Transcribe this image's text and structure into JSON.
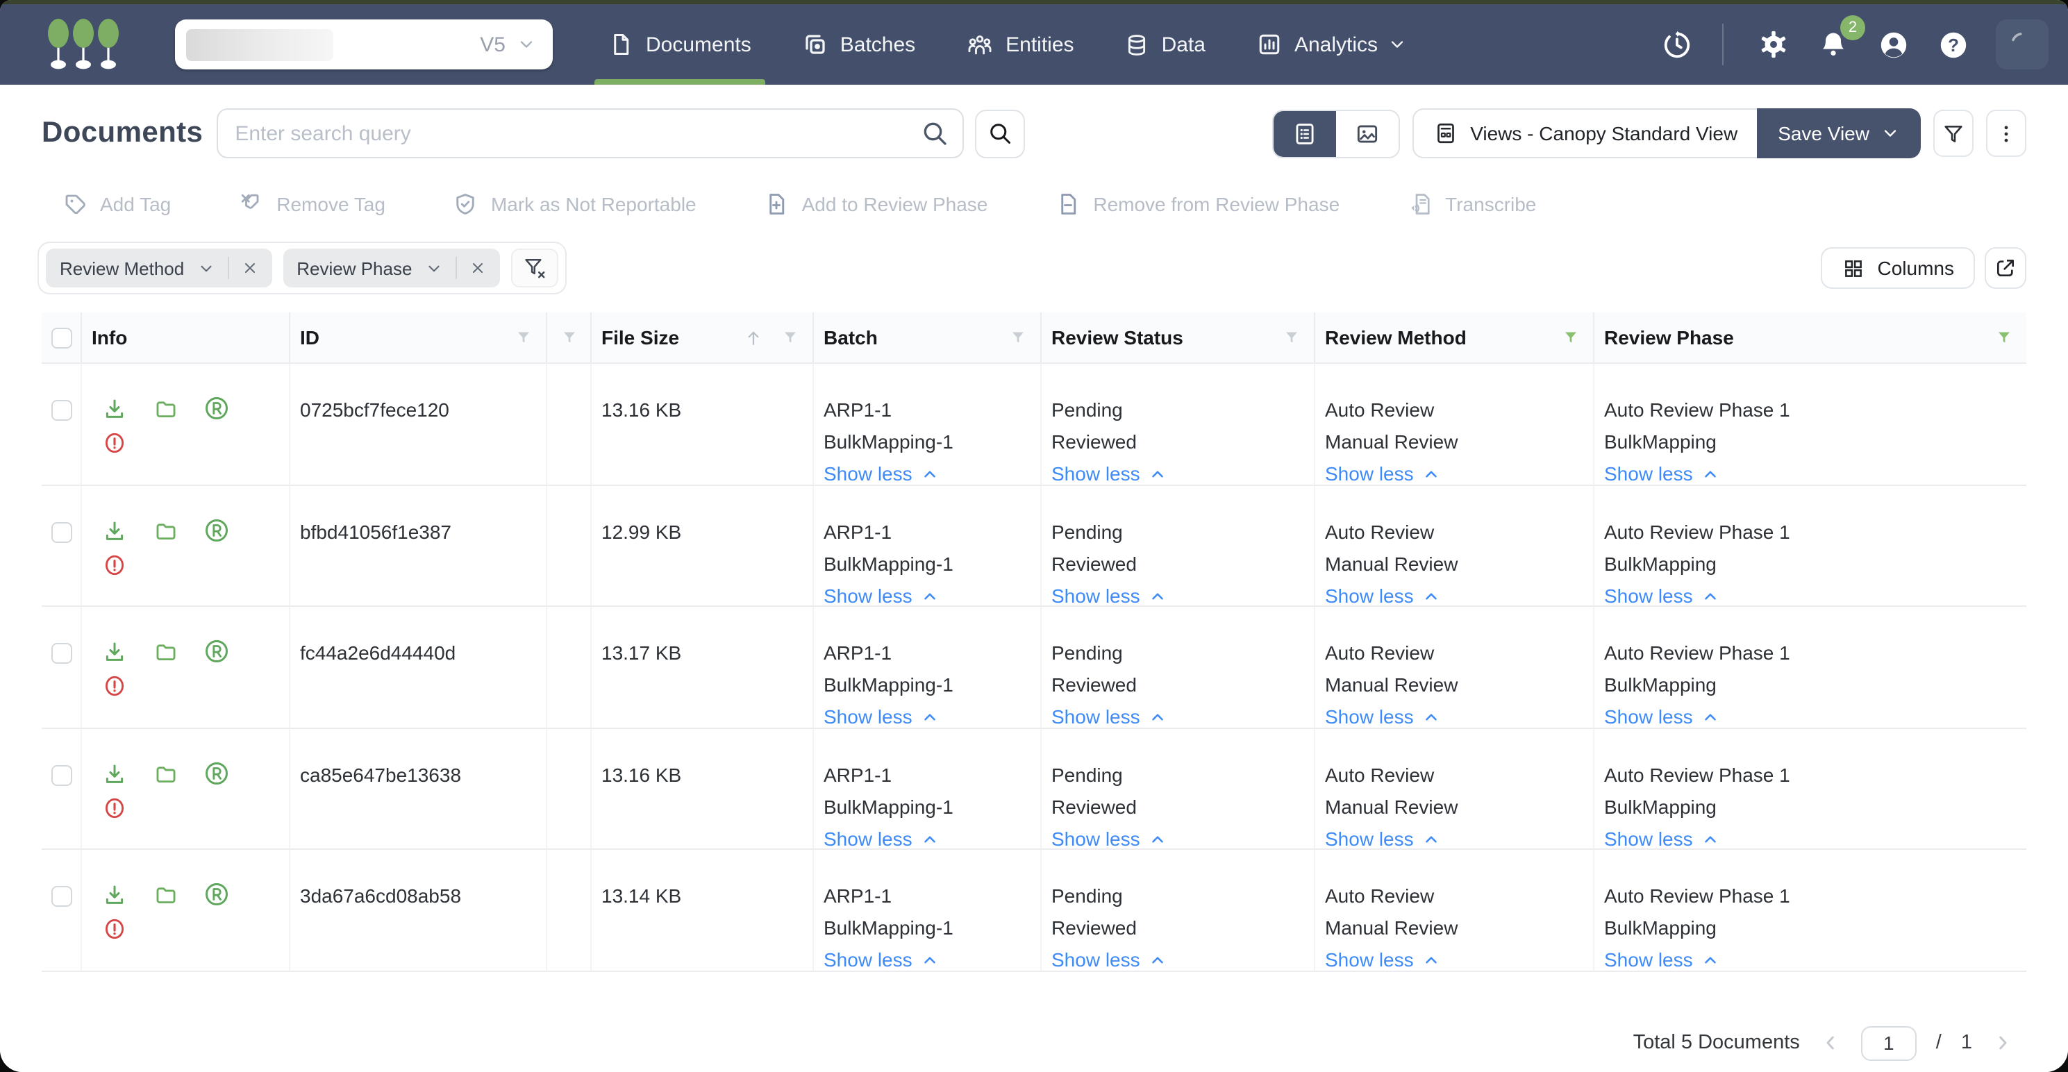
{
  "colors": {
    "topbar_bg": "#44506b",
    "accent_green": "#7dae63",
    "row_icon_green": "#5ea75c",
    "alert_red": "#d64444",
    "link_blue": "#3e8bf8",
    "active_filter_green": "#8bbf70",
    "save_button_bg": "#47536d",
    "notification_badge_green": "#85b66a"
  },
  "topbar": {
    "workspace_version": "V5",
    "notification_count": "2",
    "nav_items": [
      {
        "label": "Documents",
        "active": true
      },
      {
        "label": "Batches",
        "active": false
      },
      {
        "label": "Entities",
        "active": false
      },
      {
        "label": "Data",
        "active": false
      },
      {
        "label": "Analytics",
        "active": false,
        "dropdown": true
      }
    ]
  },
  "page": {
    "title": "Documents",
    "search_placeholder": "Enter search query",
    "views_selector_label": "Views - Canopy Standard View",
    "save_view_label": "Save View",
    "columns_button_label": "Columns"
  },
  "toolbar": {
    "actions": [
      "Add Tag",
      "Remove Tag",
      "Mark as Not Reportable",
      "Add to Review Phase",
      "Remove from Review Phase",
      "Transcribe"
    ]
  },
  "filters": {
    "chips": [
      "Review Method",
      "Review Phase"
    ]
  },
  "table": {
    "columns": [
      "Info",
      "ID",
      "File Size",
      "Batch",
      "Review Status",
      "Review Method",
      "Review Phase"
    ],
    "sorted_column": "File Size",
    "sort_direction": "asc",
    "active_filter_columns": [
      "Review Method",
      "Review Phase"
    ],
    "show_less_label": "Show less",
    "rows": [
      {
        "id": "0725bcf7fece120",
        "file_size": "13.16 KB",
        "batch": [
          "ARP1-1",
          "BulkMapping-1"
        ],
        "review_status": [
          "Pending",
          "Reviewed"
        ],
        "review_method": [
          "Auto Review",
          "Manual Review"
        ],
        "review_phase": [
          "Auto Review Phase 1",
          "BulkMapping"
        ]
      },
      {
        "id": "bfbd41056f1e387",
        "file_size": "12.99 KB",
        "batch": [
          "ARP1-1",
          "BulkMapping-1"
        ],
        "review_status": [
          "Pending",
          "Reviewed"
        ],
        "review_method": [
          "Auto Review",
          "Manual Review"
        ],
        "review_phase": [
          "Auto Review Phase 1",
          "BulkMapping"
        ]
      },
      {
        "id": "fc44a2e6d44440d",
        "file_size": "13.17 KB",
        "batch": [
          "ARP1-1",
          "BulkMapping-1"
        ],
        "review_status": [
          "Pending",
          "Reviewed"
        ],
        "review_method": [
          "Auto Review",
          "Manual Review"
        ],
        "review_phase": [
          "Auto Review Phase 1",
          "BulkMapping"
        ]
      },
      {
        "id": "ca85e647be13638",
        "file_size": "13.16 KB",
        "batch": [
          "ARP1-1",
          "BulkMapping-1"
        ],
        "review_status": [
          "Pending",
          "Reviewed"
        ],
        "review_method": [
          "Auto Review",
          "Manual Review"
        ],
        "review_phase": [
          "Auto Review Phase 1",
          "BulkMapping"
        ]
      },
      {
        "id": "3da67a6cd08ab58",
        "file_size": "13.14 KB",
        "batch": [
          "ARP1-1",
          "BulkMapping-1"
        ],
        "review_status": [
          "Pending",
          "Reviewed"
        ],
        "review_method": [
          "Auto Review",
          "Manual Review"
        ],
        "review_phase": [
          "Auto Review Phase 1",
          "BulkMapping"
        ]
      }
    ]
  },
  "footer": {
    "total_label": "Total 5 Documents",
    "page_value": "1",
    "page_separator": "/",
    "total_pages": "1"
  }
}
